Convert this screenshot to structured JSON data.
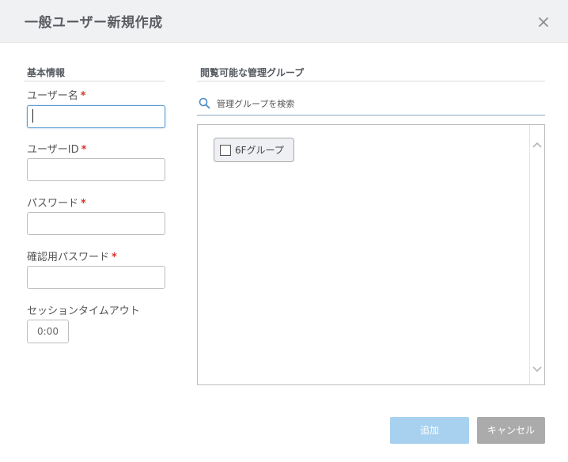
{
  "dialog": {
    "title": "一般ユーザー新規作成",
    "close_icon": "close-icon"
  },
  "basic_info": {
    "heading": "基本情報",
    "required_mark": "*",
    "fields": {
      "username": {
        "label": "ユーザー名",
        "value": ""
      },
      "userid": {
        "label": "ユーザーID",
        "value": ""
      },
      "password": {
        "label": "パスワード",
        "value": ""
      },
      "password_confirm": {
        "label": "確認用パスワード",
        "value": ""
      }
    },
    "session_timeout": {
      "label": "セッションタイムアウト",
      "value": "0:00"
    }
  },
  "groups": {
    "heading": "閲覧可能な管理グループ",
    "search": {
      "placeholder": "管理グループを検索",
      "icon": "search-icon"
    },
    "items": [
      {
        "label": "6Fグループ",
        "checked": false
      }
    ]
  },
  "buttons": {
    "add": "追加",
    "cancel": "キャンセル"
  },
  "colors": {
    "header_bg": "#f0f1f3",
    "add_button": "#a8d1f0",
    "cancel_button": "#ababab",
    "required": "#d9342b",
    "focus_border": "#5b9bd5"
  }
}
